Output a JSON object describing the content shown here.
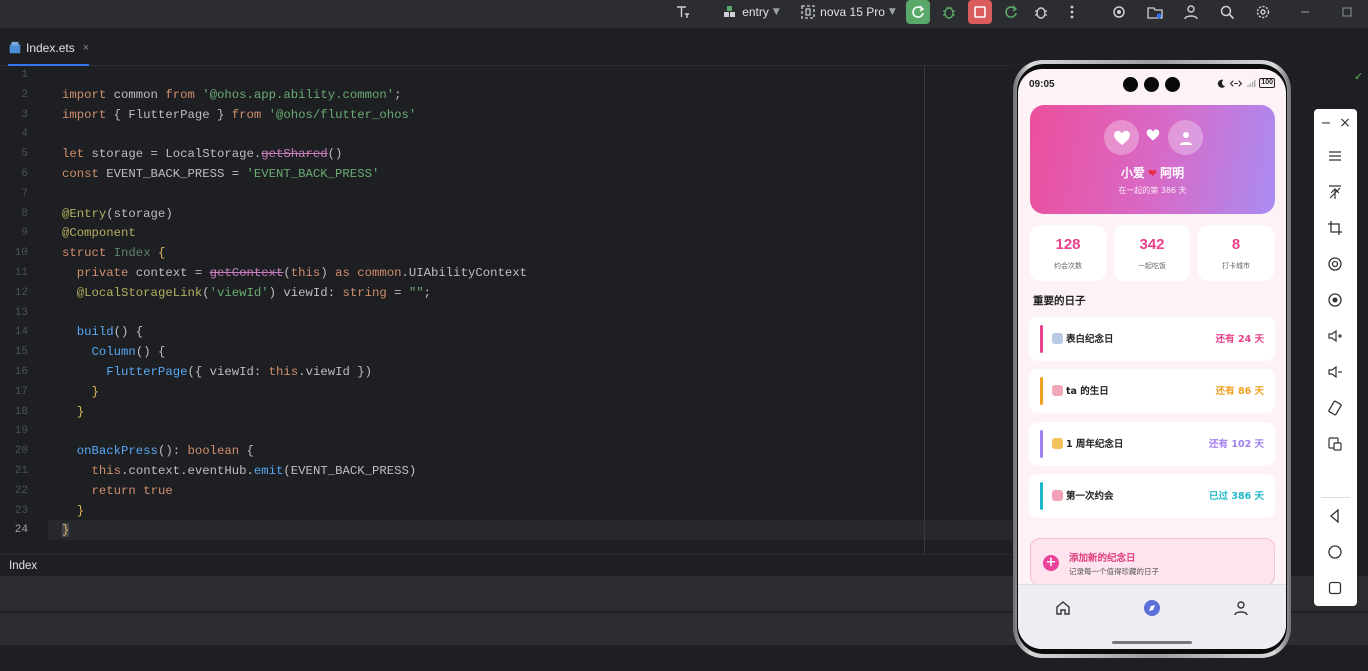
{
  "toolbar": {
    "module": "entry",
    "device": "nova 15 Pro"
  },
  "editor": {
    "tab_label": "Index.ets",
    "tab_close": "×",
    "current_line": "24",
    "line_numbers": [
      "1",
      "2",
      "3",
      "4",
      "5",
      "6",
      "7",
      "8",
      "9",
      "10",
      "11",
      "12",
      "13",
      "14",
      "15",
      "16",
      "17",
      "18",
      "19",
      "20",
      "21",
      "22",
      "23",
      "24"
    ],
    "breadcrumb": "Index",
    "code": {
      "l2": [
        "import",
        " common ",
        "from",
        " ",
        "'@ohos.app.ability.common'",
        ";"
      ],
      "l3": [
        "import",
        " { FlutterPage } ",
        "from",
        " ",
        "'@ohos/flutter_ohos'"
      ],
      "l5": [
        "let",
        " storage = LocalStorage.",
        "getShared",
        "()"
      ],
      "l6": [
        "const",
        " EVENT_BACK_PRESS = ",
        "'EVENT_BACK_PRESS'"
      ],
      "l8": [
        "@Entry",
        "(storage)"
      ],
      "l9": [
        "@Component"
      ],
      "l10": [
        "struct",
        " ",
        "Index",
        " ",
        "{"
      ],
      "l11": [
        "  ",
        "private",
        " context = ",
        "getContext",
        "(",
        "this",
        ") ",
        "as",
        " ",
        "common",
        ".UIAbilityContext"
      ],
      "l12": [
        "  ",
        "@LocalStorageLink",
        "(",
        "'viewId'",
        ") viewId: ",
        "string",
        " = ",
        "\"\"",
        ";"
      ],
      "l14": [
        "  ",
        "build",
        "() {"
      ],
      "l15": [
        "    ",
        "Column",
        "() {"
      ],
      "l16": [
        "      ",
        "FlutterPage",
        "({ viewId: ",
        "this",
        ".viewId })"
      ],
      "l17": [
        "    }"
      ],
      "l18": [
        "  }"
      ],
      "l20": [
        "  ",
        "onBackPress",
        "(): ",
        "boolean",
        " {"
      ],
      "l21": [
        "    ",
        "this",
        ".context.eventHub.",
        "emit",
        "(EVENT_BACK_PRESS)"
      ],
      "l22": [
        "    ",
        "return",
        " ",
        "true"
      ],
      "l23": [
        "  }"
      ],
      "l24": [
        "}"
      ]
    }
  },
  "phone": {
    "status": {
      "time": "09:05",
      "battery": "100"
    },
    "hero": {
      "name_a": "小爱",
      "heart": "❤",
      "name_b": "阿明",
      "subtitle": "在一起的第 386 天"
    },
    "stats": [
      {
        "value": "128",
        "label": "约会次数",
        "color": "#e8408a"
      },
      {
        "value": "342",
        "label": "一起吃饭",
        "color": "#e8408a"
      },
      {
        "value": "8",
        "label": "打卡城市",
        "color": "#e8408a"
      }
    ],
    "section_title": "重要的日子",
    "days": [
      {
        "name": "表白纪念日",
        "count": "还有 24 天",
        "color": "#e8408a"
      },
      {
        "name": "ta 的生日",
        "count": "还有 86 天",
        "color": "#f0a020"
      },
      {
        "name": "1 周年纪念日",
        "count": "还有 102 天",
        "color": "#a27ff0"
      },
      {
        "name": "第一次约会",
        "count": "已过 386 天",
        "color": "#20b8c8"
      }
    ],
    "add_card": {
      "plus": "+",
      "title": "添加新的纪念日",
      "subtitle": "记录每一个值得珍藏的日子"
    },
    "nav": [
      "home-icon",
      "compass-icon",
      "profile-icon"
    ],
    "accent": "#e9439a"
  },
  "side_panel": {
    "minimize": "−",
    "close": "×"
  }
}
